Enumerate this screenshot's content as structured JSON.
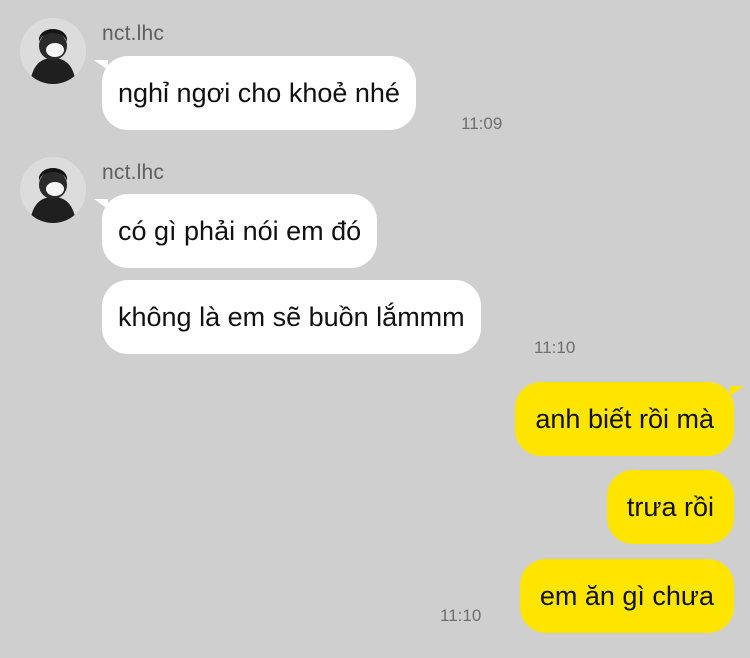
{
  "messages": [
    {
      "sender": "nct.lhc",
      "lines": [
        "nghỉ ngơi cho khoẻ nhé"
      ],
      "time": "11:09"
    },
    {
      "sender": "nct.lhc",
      "lines": [
        "có gì phải nói em đó",
        "không là em sẽ buồn lắmmm"
      ],
      "time": "11:10"
    },
    {
      "sender": "me",
      "lines": [
        "anh biết rồi mà",
        "trưa rồi",
        "em ăn gì chưa"
      ],
      "time": "11:10"
    }
  ],
  "colors": {
    "background": "#cfcfcf",
    "incoming_bubble": "#ffffff",
    "outgoing_bubble": "#fee500"
  },
  "icons": {
    "avatar": "profile-photo-avatar"
  }
}
